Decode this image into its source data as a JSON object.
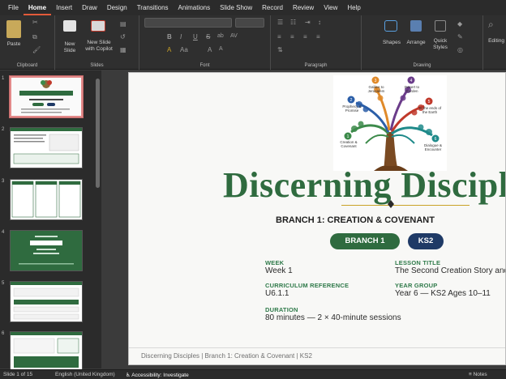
{
  "menu": {
    "tabs": [
      "File",
      "Home",
      "Insert",
      "Draw",
      "Design",
      "Transitions",
      "Animations",
      "Slide Show",
      "Record",
      "Review",
      "View",
      "Help"
    ],
    "active_tab": "Home"
  },
  "ribbon": {
    "clipboard": {
      "paste_label": "Paste",
      "group_label": "Clipboard"
    },
    "slides": {
      "new_slide_label": "New Slide",
      "new_slide_copilot_label": "New Slide with Copilot",
      "group_label": "Slides"
    },
    "font": {
      "group_label": "Font",
      "format_glyphs": [
        "B",
        "I",
        "U",
        "S",
        "ab",
        "AV",
        "Aa",
        "A",
        "A",
        "A"
      ]
    },
    "paragraph": {
      "group_label": "Paragraph"
    },
    "drawing": {
      "shapes_label": "Shapes",
      "arrange_label": "Arrange",
      "quick_styles_label": "Quick Styles",
      "group_label": "Drawing"
    },
    "editing": {
      "label": "Editing"
    }
  },
  "thumbnails": [
    {
      "number": "1",
      "selected": true
    },
    {
      "number": "2",
      "selected": false
    },
    {
      "number": "3",
      "selected": false
    },
    {
      "number": "4",
      "selected": false
    },
    {
      "number": "5",
      "selected": false
    },
    {
      "number": "6",
      "selected": false
    }
  ],
  "slide": {
    "tree_labels": {
      "b1": "Creation & Covenant",
      "b2": "Prophecy & Promise",
      "b3": "Galilee to Jerusalem",
      "b4": "Desert to Garden",
      "b5": "To the ends of the Earth",
      "b6": "Dialogue & Encounter"
    },
    "title": "Discerning Disciples",
    "branch_heading": "BRANCH 1: CREATION & COVENANT",
    "pills": {
      "branch": "BRANCH 1",
      "stage": "KS2"
    },
    "fields": {
      "week_label": "WEEK",
      "week_value": "Week 1",
      "lesson_label": "LESSON TITLE",
      "lesson_value": "The Second Creation Story and",
      "curriculum_label": "CURRICULUM REFERENCE",
      "curriculum_value": "U6.1.1",
      "year_label": "YEAR GROUP",
      "year_value": "Year 6 — KS2 Ages 10–11",
      "duration_label": "DURATION",
      "duration_value": "80 minutes — 2 × 40-minute sessions"
    },
    "footer": "Discerning Disciples | Branch 1: Creation & Covenant | KS2"
  },
  "status": {
    "slide_count": "Slide 1 of 15",
    "language": "English (United Kingdom)",
    "accessibility": "Accessibility: Investigate",
    "notes": "Notes"
  },
  "colors": {
    "accent": "#2f6b3f",
    "pill_green": "#2f6b3f",
    "pill_navy": "#1f3a66",
    "gold": "#c9a227"
  }
}
